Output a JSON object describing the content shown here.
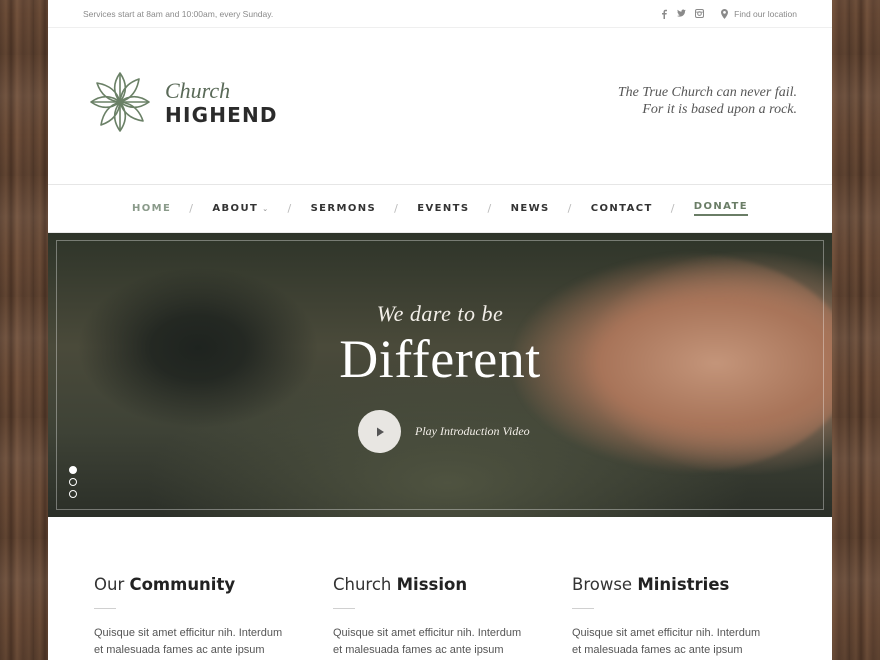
{
  "topbar": {
    "services_text": "Services start at 8am and 10:00am, every Sunday.",
    "social_icons": [
      "facebook-icon",
      "twitter-icon",
      "instagram-icon"
    ],
    "location_link": "Find our location"
  },
  "header": {
    "logo_script": "Church",
    "logo_name": "HIGHEND",
    "tagline_line1": "The True Church can never fail.",
    "tagline_line2": "For it is based upon a rock."
  },
  "nav": {
    "items": [
      {
        "label": "HOME"
      },
      {
        "label": "ABOUT"
      },
      {
        "label": "SERMONS"
      },
      {
        "label": "EVENTS"
      },
      {
        "label": "NEWS"
      },
      {
        "label": "CONTACT"
      },
      {
        "label": "DONATE"
      }
    ]
  },
  "hero": {
    "subtitle": "We dare to be",
    "title": "Different",
    "video_label": "Play Introduction Video",
    "slides": 3,
    "active_slide": 1
  },
  "columns": [
    {
      "light": "Our",
      "bold": "Community",
      "text": "Quisque sit amet efficitur nih. Interdum et malesuada fames ac ante ipsum primis in"
    },
    {
      "light": "Church",
      "bold": "Mission",
      "text": "Quisque sit amet efficitur nih. Interdum et malesuada fames ac ante ipsum primis in"
    },
    {
      "light": "Browse",
      "bold": "Ministries",
      "text": "Quisque sit amet efficitur nih. Interdum et malesuada fames ac ante ipsum primis in"
    }
  ],
  "colors": {
    "accent": "#6a7d66",
    "text": "#333333",
    "muted": "#8a8a8a"
  }
}
